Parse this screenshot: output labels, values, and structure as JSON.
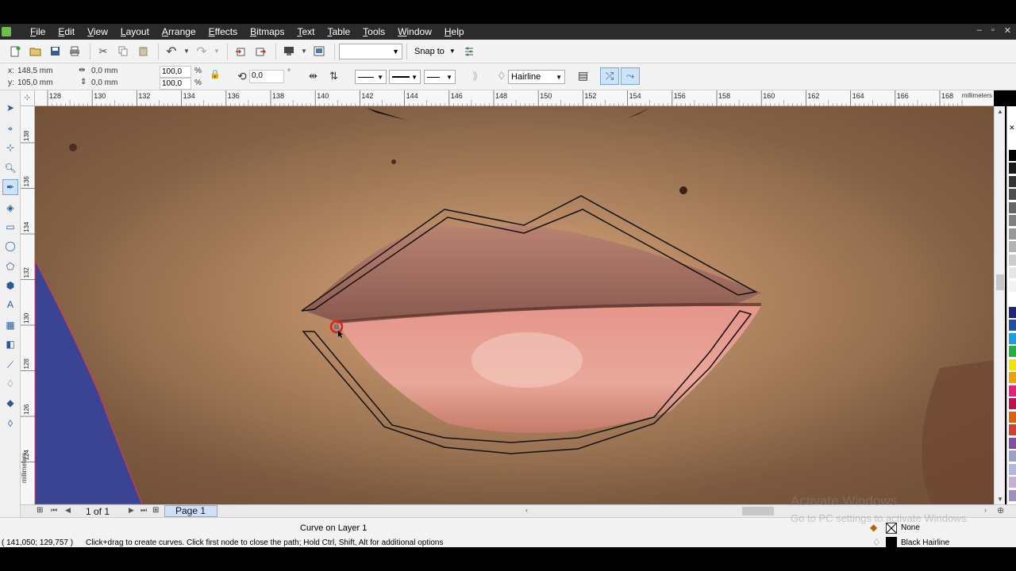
{
  "menubar": {
    "items": [
      "File",
      "Edit",
      "View",
      "Layout",
      "Arrange",
      "Effects",
      "Bitmaps",
      "Text",
      "Table",
      "Tools",
      "Window",
      "Help"
    ],
    "window_controls": [
      "–",
      "▫",
      "✕"
    ]
  },
  "toolbar": {
    "font_dropdown_value": "",
    "snap_to_label": "Snap to"
  },
  "properties": {
    "x_label": "x:",
    "x_value": "148,5 mm",
    "y_label": "y:",
    "y_value": "105,0 mm",
    "width_value": "0,0 mm",
    "height_value": "0,0 mm",
    "scale_x": "100,0",
    "scale_y": "100,0",
    "percent_symbol": "%",
    "rotation_value": "0,0",
    "degree_symbol": "°",
    "outline_width": "Hairline"
  },
  "rulers": {
    "unit_label": "millimeters",
    "top_ticks": [
      "128",
      "130",
      "132",
      "134",
      "136",
      "138",
      "140",
      "142",
      "144",
      "146",
      "148",
      "150",
      "152",
      "154",
      "156",
      "158",
      "160",
      "162",
      "164",
      "166",
      "168"
    ],
    "left_ticks": [
      "138",
      "136",
      "134",
      "132",
      "130",
      "128",
      "126",
      "124"
    ],
    "left_unit_label": "millimeters"
  },
  "pagebar": {
    "page_count": "1 of 1",
    "page_tab": "Page 1"
  },
  "status": {
    "object_info": "Curve on Layer 1",
    "cursor_coords": "( 141,050; 129,757 )",
    "hint": "Click+drag to create curves. Click first node to close the path; Hold Ctrl, Shift, Alt for additional options",
    "fill_label": "None",
    "outline_label": "Black  Hairline"
  },
  "watermark": {
    "title": "Activate Windows",
    "subtitle": "Go to PC settings to activate Windows."
  },
  "colors": {
    "menubar_bg": "#2b2b2b",
    "canvas_skin": "#c9946a",
    "lip_color": "#d98a78",
    "blue_region": "#3a4493",
    "accent_blue": "#2a5a9a"
  },
  "palette_colors": [
    "#ffffff",
    "#000000",
    "#1a1a1a",
    "#333333",
    "#4d4d4d",
    "#666666",
    "#808080",
    "#999999",
    "#b3b3b3",
    "#cccccc",
    "#e6e6e6",
    "#f2f2f2",
    "#ffffff",
    "#22237a",
    "#1f4ea8",
    "#1aa0e0",
    "#20b040",
    "#f5e400",
    "#f0a000",
    "#e8207a",
    "#c01050",
    "#e06010",
    "#d04030",
    "#8050a0",
    "#9aa0c8",
    "#b0b8e0",
    "#c8b0d8",
    "#a090c0"
  ]
}
